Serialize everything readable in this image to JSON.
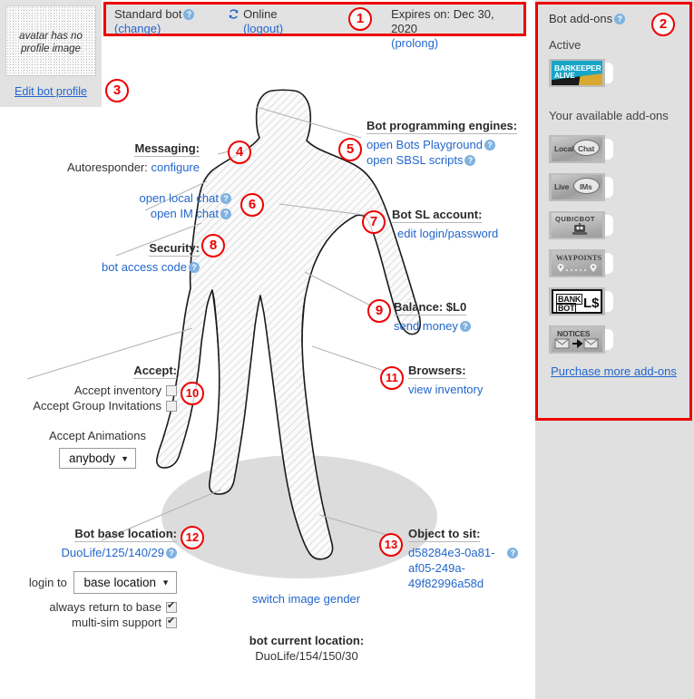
{
  "avatar": {
    "placeholder_text": "avatar has no profile image",
    "edit_link": "Edit bot profile"
  },
  "status_bar": {
    "bot_type": "Standard bot",
    "bot_type_change": "(change)",
    "online_state": "Online",
    "logout": "(logout)",
    "expires": "Expires on: Dec 30, 2020",
    "prolong": "(prolong)"
  },
  "addons": {
    "title": "Bot add-ons",
    "active_label": "Active",
    "available_label": "Your available add-ons",
    "active_items": [
      {
        "name": "BARKEEPER ALIVE",
        "line1": "BARKEEPER",
        "line2": "ALIVE"
      }
    ],
    "available_items": [
      {
        "name": "Local Chat",
        "line1": "Local",
        "line2": "Chat"
      },
      {
        "name": "Live IMs",
        "line1": "Live",
        "line2": "IMs"
      },
      {
        "name": "QubicBot",
        "line1": "QUBICBOT",
        "line2": ""
      },
      {
        "name": "Waypoints",
        "line1": "WAYPOINTS",
        "line2": ""
      },
      {
        "name": "Bank Bot",
        "line1": "BANK",
        "line2": "BOT"
      },
      {
        "name": "Notices",
        "line1": "NOTICES",
        "line2": ""
      }
    ],
    "purchase_link": "Purchase more add-ons"
  },
  "annotations": {
    "messaging": {
      "heading": "Messaging:",
      "autoresponder_label": "Autoresponder:",
      "autoresponder_link": "configure"
    },
    "chat": {
      "local_chat": "open local chat",
      "im_chat": "open IM chat"
    },
    "security": {
      "heading": "Security:",
      "access_code": "bot access code"
    },
    "engines": {
      "heading": "Bot programming engines:",
      "playground": "open Bots Playground",
      "sbsl": "open SBSL scripts"
    },
    "sl_account": {
      "heading": "Bot SL account:",
      "edit_link": "edit login/password"
    },
    "balance": {
      "heading": "Balance: $L0",
      "send_money": "send money"
    },
    "browsers": {
      "heading": "Browsers:",
      "view_inventory": "view inventory"
    },
    "accept": {
      "heading": "Accept:",
      "inventory_label": "Accept inventory",
      "group_invites_label": "Accept Group Invitations",
      "animations_label": "Accept Animations",
      "animations_value": "anybody"
    },
    "base_location": {
      "heading": "Bot base location:",
      "value": "DuoLife/125/140/29",
      "login_to_label": "login to",
      "login_to_value": "base location",
      "always_return_label": "always return to base",
      "multi_sim_label": "multi-sim support"
    },
    "object_to_sit": {
      "heading": "Object to sit:",
      "value_line1": "d58284e3-0a81-",
      "value_line2": "af05-249a-",
      "value_line3": "49f82996a58d"
    },
    "switch_gender": "switch image gender",
    "current_location": {
      "heading": "bot current location:",
      "value": "DuoLife/154/150/30"
    }
  },
  "markers": {
    "m1": "1",
    "m2": "2",
    "m3": "3",
    "m4": "4",
    "m5": "5",
    "m6": "6",
    "m7": "7",
    "m8": "8",
    "m9": "9",
    "m10": "10",
    "m11": "11",
    "m12": "12",
    "m13": "13"
  },
  "colors": {
    "accent_red": "#ee0000",
    "link_blue": "#2266cc",
    "panel_gray": "#e0e0e0",
    "help_blue": "#7fb2e0"
  }
}
